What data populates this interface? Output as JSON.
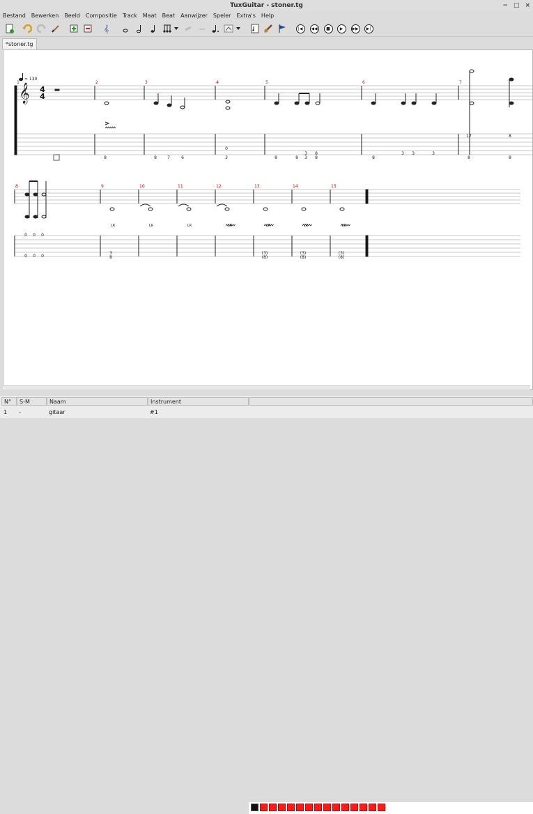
{
  "window": {
    "title": "TuxGuitar - stoner.tg",
    "controls": [
      "−",
      "□",
      "×"
    ]
  },
  "menu": [
    "Bestand",
    "Bewerken",
    "Beeld",
    "Compositie",
    "Track",
    "Maat",
    "Beat",
    "Aanwijzer",
    "Speler",
    "Extra's",
    "Help"
  ],
  "tab": {
    "label": "*stoner.tg"
  },
  "score": {
    "tempo": "= 130",
    "time_signature": {
      "top": "4",
      "bottom": "4"
    },
    "measure_numbers": [
      "1",
      "2",
      "3",
      "4",
      "5",
      "6",
      "7",
      "8",
      "9",
      "10",
      "11",
      "12",
      "13",
      "14",
      "15"
    ],
    "tab_numbers_row1": [
      "8",
      "8",
      "7",
      "6",
      "0",
      "3",
      "8",
      "8",
      "3",
      "8",
      "3",
      "8",
      "8",
      "3",
      "3",
      "3",
      "17",
      "8",
      "8",
      "8"
    ],
    "tab_numbers_row2": [
      "0",
      "0",
      "0",
      "0",
      "0",
      "0",
      "3",
      "8",
      "(3)",
      "(8)",
      "(3)",
      "(8)",
      "(3)",
      "(8)"
    ],
    "lr_labels": [
      "LR",
      "LR",
      "LR",
      "LR",
      "LR",
      "LR",
      "LR"
    ]
  },
  "colors": {
    "measure_number": "#e00000",
    "timeline_cell": "#ff1a1a",
    "accent_flag": "#1a4aa8"
  },
  "tracks": {
    "headers": {
      "num": "N°",
      "sm": "S-M",
      "name": "Naam",
      "instrument": "Instrument"
    },
    "rows": [
      {
        "num": "1",
        "sm": "-",
        "name": "gitaar",
        "instrument": "#1"
      }
    ],
    "timeline_filled": 15
  }
}
